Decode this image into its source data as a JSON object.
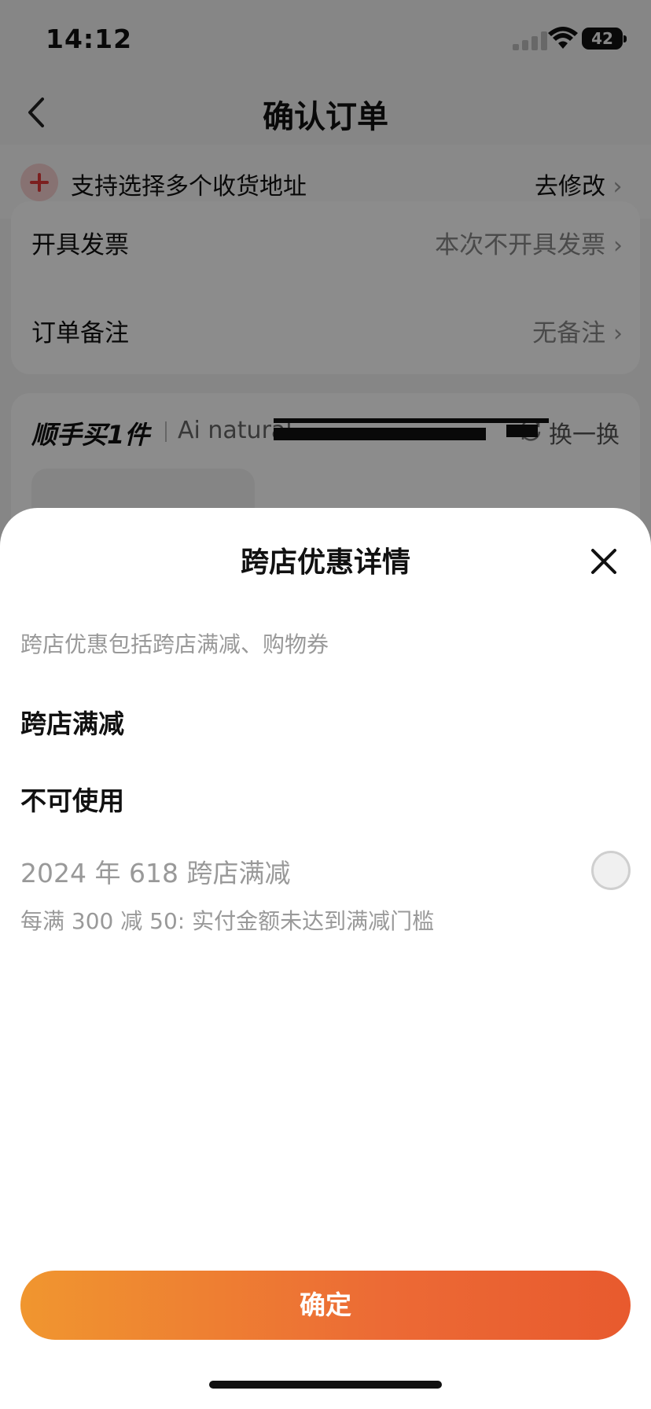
{
  "status_bar": {
    "time": "14:12",
    "battery": "42"
  },
  "nav": {
    "title": "确认订单"
  },
  "address_bar": {
    "text": "支持选择多个收货地址",
    "edit": "去修改"
  },
  "order_card": {
    "invoice_label": "开具发票",
    "invoice_value": "本次不开具发票",
    "remark_label": "订单备注",
    "remark_value": "无备注"
  },
  "upsell_card": {
    "title": "顺手买1件",
    "brand": "Ai natural",
    "swap": "换一换"
  },
  "sheet": {
    "title": "跨店优惠详情",
    "subtitle": "跨店优惠包括跨店满减、购物券",
    "section_full_reduction": "跨店满减",
    "section_unavailable": "不可使用",
    "promo_name": "2024 年 618 跨店满减",
    "promo_desc": "每满 300 减 50: 实付金额未达到满减门槛",
    "confirm": "确定"
  },
  "icons": {
    "back": "chevron-left-icon",
    "add": "plus-icon",
    "chevron": "chevron-right-icon",
    "swap": "refresh-icon",
    "close": "close-icon"
  },
  "colors": {
    "accent_start": "#f0962f",
    "accent_end": "#e85a2e",
    "add_icon": "#e23a3a"
  }
}
